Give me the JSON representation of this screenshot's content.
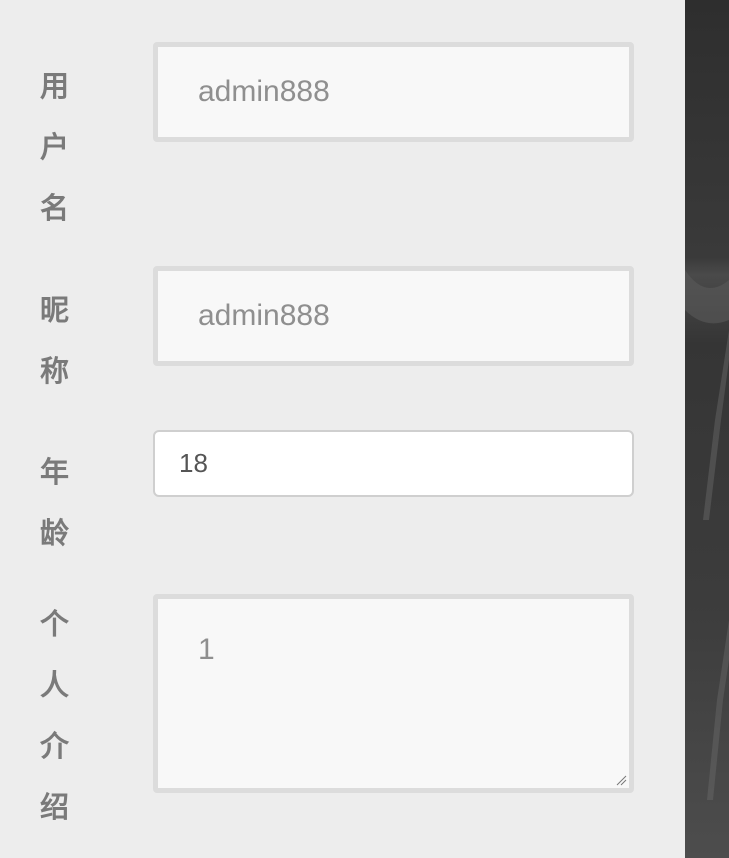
{
  "form": {
    "username": {
      "label": "用户名",
      "value": "admin888"
    },
    "nickname": {
      "label": "昵称",
      "value": "admin888"
    },
    "age": {
      "label": "年龄",
      "value": "18"
    },
    "bio": {
      "label": "个人介绍",
      "value": "1"
    }
  },
  "colors": {
    "page_background": "#ededed",
    "label_text": "#7a7a7a",
    "readonly_field_background": "#f8f8f8",
    "readonly_field_border": "#dcdcdc",
    "input_background": "#ffffff",
    "side_panel": "#333333"
  },
  "icons": {
    "textarea_resize": "resize-grip-icon"
  }
}
